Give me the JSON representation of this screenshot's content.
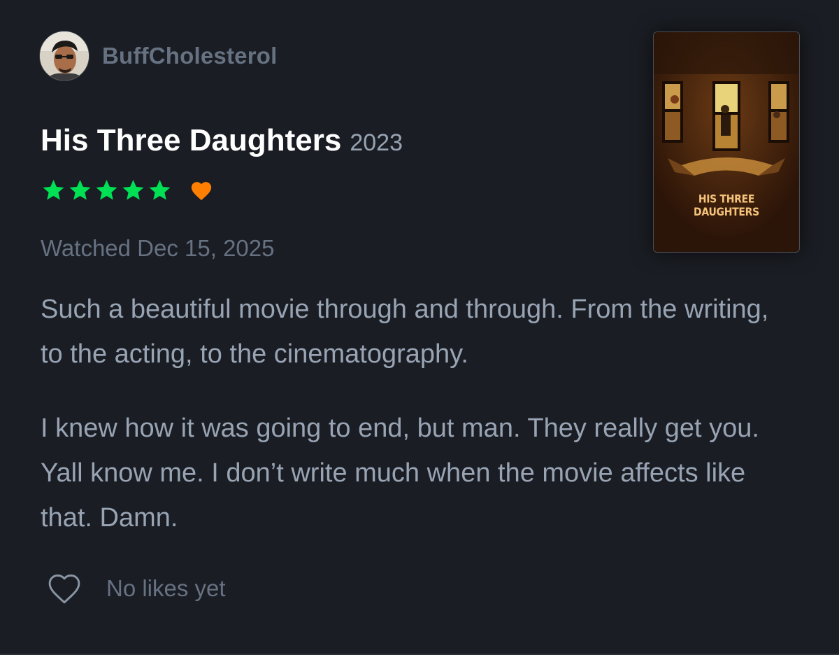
{
  "user": {
    "username": "BuffCholesterol",
    "avatar_icon": "user-avatar-photo"
  },
  "film": {
    "title": "His Three Daughters",
    "year": "2023",
    "poster_title_line1": "HIS THREE",
    "poster_title_line2": "DAUGHTERS"
  },
  "rating": {
    "stars": 5,
    "max_stars": 5,
    "star_color": "#00e054",
    "liked": true,
    "liked_color": "#ff8000"
  },
  "watched_label": "Watched Dec 15, 2025",
  "review": {
    "paragraphs": [
      "Such a beautiful movie through and through. From the writing, to the acting, to the cinematography.",
      "I knew how it was going to end, but man. They really get you. Yall know me. I don’t write much when the movie affects like that. Damn."
    ]
  },
  "likes": {
    "label": "No likes yet",
    "icon": "heart-outline-icon"
  }
}
